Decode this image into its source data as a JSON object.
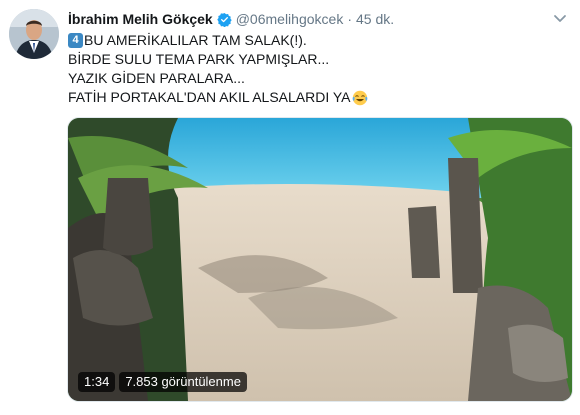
{
  "tweet": {
    "display_name": "İbrahim Melih Gökçek",
    "handle": "@06melihgokcek",
    "separator": "·",
    "timestamp": "45 dk.",
    "keycap": "4",
    "lines": [
      "BU AMERİKALILAR TAM SALAK(!).",
      "BİRDE SULU TEMA PARK YAPMIŞLAR...",
      "YAZIK GİDEN PARALARA...",
      "FATİH PORTAKAL'DAN AKIL ALSALARDI YA"
    ],
    "emoji": "face-with-tears-of-joy"
  },
  "video": {
    "duration": "1:34",
    "views": "7.853 görüntülenme"
  },
  "icons": {
    "verified": "verified-badge-icon",
    "caret": "chevron-down-icon"
  },
  "colors": {
    "verified_blue": "#1da1f2",
    "secondary_text": "#657786",
    "keycap_blue": "#3b88c3"
  }
}
